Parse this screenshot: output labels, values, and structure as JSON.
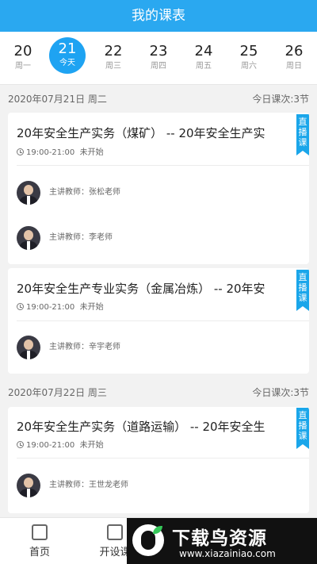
{
  "header": {
    "title": "我的课表"
  },
  "week": [
    {
      "num": "20",
      "label": "周一"
    },
    {
      "num": "21",
      "label": "今天",
      "active": true
    },
    {
      "num": "22",
      "label": "周三"
    },
    {
      "num": "23",
      "label": "周四"
    },
    {
      "num": "24",
      "label": "周五"
    },
    {
      "num": "25",
      "label": "周六"
    },
    {
      "num": "26",
      "label": "周日"
    }
  ],
  "days": [
    {
      "date": "2020年07月21日 周二",
      "count": "今日课次:3节",
      "courses": [
        {
          "title": "20年安全生产实务（煤矿） -- 20年安全生产实",
          "time": "19:00-21:00",
          "status": "未开始",
          "badge": "直播课",
          "teachers": [
            "主讲教师：张松老师",
            "主讲教师：李老师"
          ]
        },
        {
          "title": "20年安全生产专业实务（金属冶炼） -- 20年安",
          "time": "19:00-21:00",
          "status": "未开始",
          "badge": "直播课",
          "teachers": [
            "主讲教师：辛宇老师"
          ]
        }
      ]
    },
    {
      "date": "2020年07月22日 周三",
      "count": "今日课次:3节",
      "courses": [
        {
          "title": "20年安全生产实务（道路运输） -- 20年安全生",
          "time": "19:00-21:00",
          "status": "未开始",
          "badge": "直播课",
          "teachers": [
            "主讲教师：王世龙老师"
          ]
        }
      ]
    }
  ],
  "tabbar": [
    {
      "label": "首页",
      "icon": "list-icon"
    },
    {
      "label": "开设课",
      "icon": "book-icon"
    }
  ],
  "watermark": {
    "title": "下载鸟资源",
    "url": "www.xiazainiao.com"
  }
}
